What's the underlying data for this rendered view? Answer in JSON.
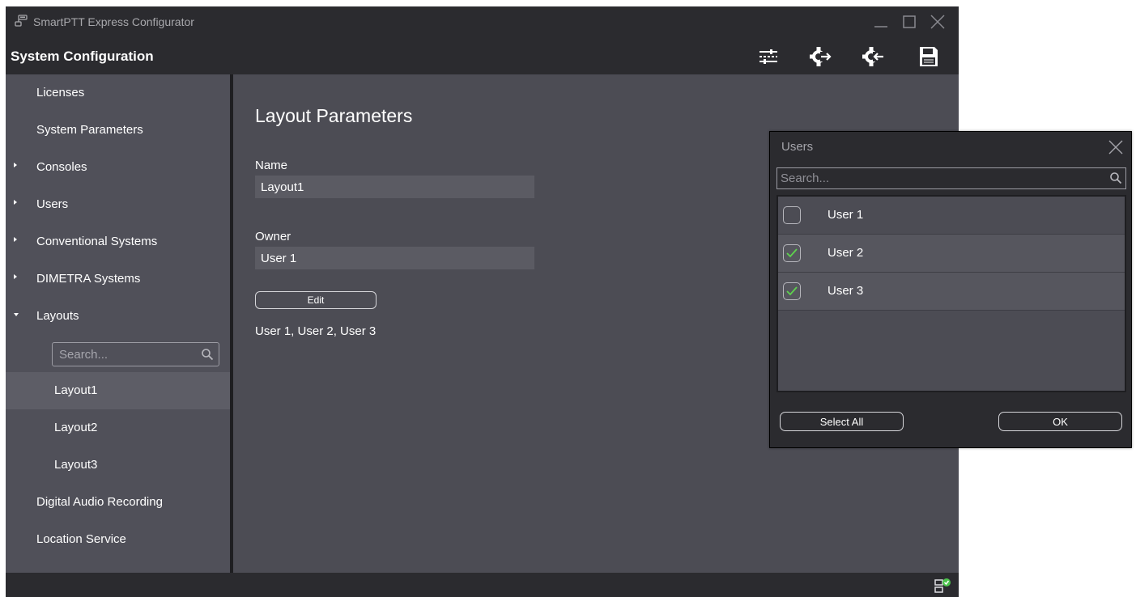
{
  "window": {
    "title": "SmartPTT Express Configurator",
    "icons": [
      "app-icon",
      "minimize-icon",
      "maximize-icon",
      "close-icon"
    ]
  },
  "header": {
    "title": "System Configuration",
    "toolbar_icons": [
      "settings-sliders-icon",
      "export-config-icon",
      "import-config-icon",
      "save-icon"
    ]
  },
  "sidebar": {
    "items": [
      {
        "label": "Licenses"
      },
      {
        "label": "System Parameters"
      },
      {
        "label": "Consoles",
        "expander": "collapsed"
      },
      {
        "label": "Users",
        "expander": "collapsed"
      },
      {
        "label": "Conventional Systems",
        "expander": "collapsed"
      },
      {
        "label": "DIMETRA Systems",
        "expander": "collapsed"
      },
      {
        "label": "Layouts",
        "expander": "expanded"
      },
      {
        "label": "Layout1",
        "selected": true
      },
      {
        "label": "Layout2"
      },
      {
        "label": "Layout3"
      },
      {
        "label": "Digital Audio Recording"
      },
      {
        "label": "Location Service"
      }
    ],
    "search_placeholder": "Search..."
  },
  "main": {
    "title": "Layout Parameters",
    "name_label": "Name",
    "name_value": "Layout1",
    "owner_label": "Owner",
    "owner_value": "User 1",
    "edit_button": "Edit",
    "users_summary": "User 1, User 2, User 3"
  },
  "status": {
    "icon": "server-ok-icon"
  },
  "dialog": {
    "title": "Users",
    "search_placeholder": "Search...",
    "users": [
      {
        "name": "User 1",
        "checked": false
      },
      {
        "name": "User 2",
        "checked": true
      },
      {
        "name": "User 3",
        "checked": true
      }
    ],
    "select_all_button": "Select All",
    "ok_button": "OK"
  },
  "colors": {
    "titlebar_bg": "#2b2b2f",
    "sidebar_bg": "#505059",
    "main_bg": "#4c4c54",
    "selected_bg": "#5d5d66",
    "check_green": "#5ed24e",
    "status_green": "#4cc44c"
  }
}
